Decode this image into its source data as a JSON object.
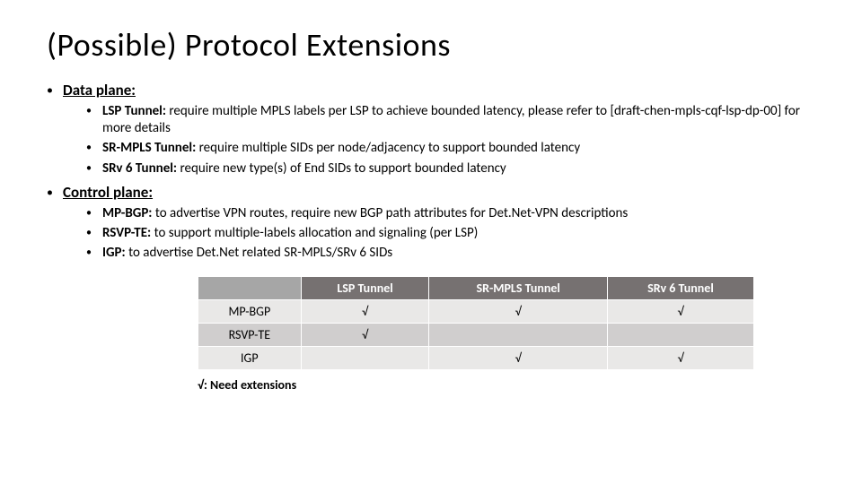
{
  "title": "(Possible) Protocol Extensions",
  "sections": [
    {
      "label": "Data plane:",
      "items": [
        {
          "term": "LSP Tunnel:",
          "text": " require multiple MPLS labels per LSP to achieve bounded latency, please refer to  [draft-chen-mpls-cqf-lsp-dp-00] for more details"
        },
        {
          "term": "SR-MPLS Tunnel:",
          "text": " require multiple SIDs per node/adjacency to support bounded latency"
        },
        {
          "term": "SRv 6 Tunnel:",
          "text": " require new type(s) of End SIDs to support bounded latency"
        }
      ]
    },
    {
      "label": "Control plane:",
      "items": [
        {
          "term": "MP-BGP:",
          "text": " to advertise VPN routes, require new BGP path attributes for Det.Net-VPN descriptions"
        },
        {
          "term": "RSVP-TE:",
          "text": " to support multiple-labels allocation and signaling (per LSP)"
        },
        {
          "term": "IGP:",
          "text": " to advertise Det.Net related SR-MPLS/SRv 6 SIDs"
        }
      ]
    }
  ],
  "table": {
    "columns": [
      "LSP Tunnel",
      "SR-MPLS Tunnel",
      "SRv 6 Tunnel"
    ],
    "rows": [
      {
        "head": "MP-BGP",
        "cells": [
          "√",
          "√",
          "√"
        ]
      },
      {
        "head": "RSVP-TE",
        "cells": [
          "√",
          "",
          ""
        ]
      },
      {
        "head": "IGP",
        "cells": [
          "",
          "√",
          "√"
        ]
      }
    ]
  },
  "legend": "√: Need extensions",
  "glyph": {
    "bullet": "•"
  },
  "chart_data": {
    "type": "table",
    "title": "Protocol extensions needed per tunnel type",
    "columns": [
      "",
      "LSP Tunnel",
      "SR-MPLS Tunnel",
      "SRv 6 Tunnel"
    ],
    "rows": [
      [
        "MP-BGP",
        "√",
        "√",
        "√"
      ],
      [
        "RSVP-TE",
        "√",
        "",
        ""
      ],
      [
        "IGP",
        "",
        "√",
        "√"
      ]
    ],
    "legend": "√: Need extensions"
  }
}
